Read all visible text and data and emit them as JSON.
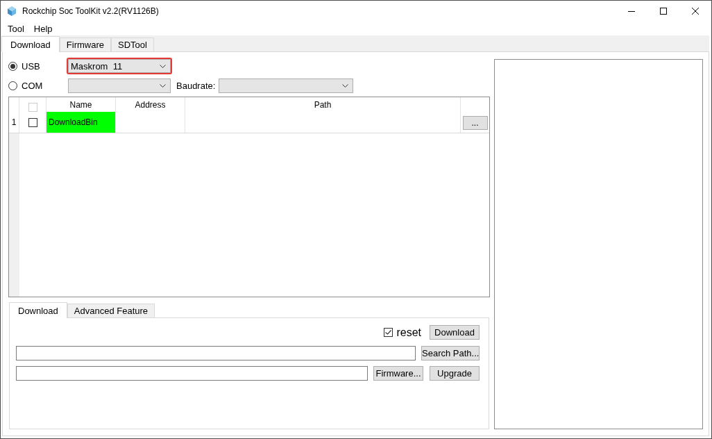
{
  "window": {
    "title": "Rockchip Soc ToolKit v2.2(RV1126B)"
  },
  "menu": [
    "Tool",
    "Help"
  ],
  "tabs": [
    {
      "label": "Download",
      "selected": true
    },
    {
      "label": "Firmware",
      "selected": false
    },
    {
      "label": "SDTool",
      "selected": false
    }
  ],
  "connection": {
    "options": [
      {
        "label": "USB",
        "selected": true
      },
      {
        "label": "COM",
        "selected": false
      }
    ],
    "usb_device": {
      "value": "Maskrom  11",
      "highlighted": true
    },
    "baudrate_label": "Baudrate:"
  },
  "table": {
    "select_all": {
      "checked": false,
      "disabled": true
    },
    "columns": [
      "Name",
      "Address",
      "Path"
    ],
    "rows": [
      {
        "number": "1",
        "checked": false,
        "name": "DownloadBin",
        "color": "#00ff00",
        "button": "..."
      }
    ]
  },
  "lower_tabs": [
    {
      "label": "Download",
      "selected": true
    },
    {
      "label": "Advanced Feature",
      "selected": false
    }
  ],
  "download_panel": {
    "reset": {
      "label": "reset",
      "checked": true
    },
    "download_button": "Download",
    "search_path_button": "Search Path...",
    "firmware_button": "Firmware...",
    "upgrade_button": "Upgrade"
  }
}
